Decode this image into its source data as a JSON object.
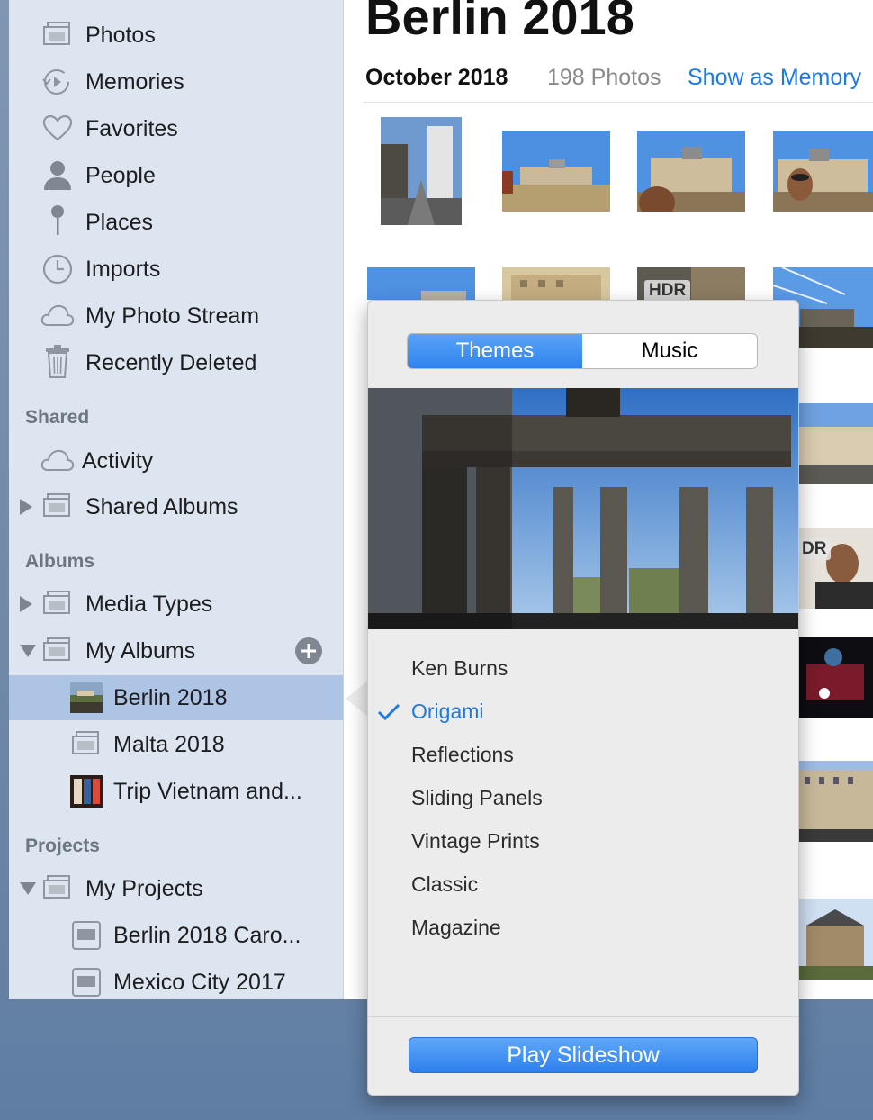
{
  "sidebar": {
    "library_items": [
      {
        "label": "Photos",
        "icon": "photos-stack-icon"
      },
      {
        "label": "Memories",
        "icon": "memories-icon"
      },
      {
        "label": "Favorites",
        "icon": "heart-icon"
      },
      {
        "label": "People",
        "icon": "person-icon"
      },
      {
        "label": "Places",
        "icon": "pin-icon"
      },
      {
        "label": "Imports",
        "icon": "clock-icon"
      },
      {
        "label": "My Photo Stream",
        "icon": "cloud-icon"
      },
      {
        "label": "Recently Deleted",
        "icon": "trash-icon"
      }
    ],
    "shared_header": "Shared",
    "shared_items": [
      {
        "label": "Activity",
        "icon": "cloud-icon"
      },
      {
        "label": "Shared Albums",
        "icon": "album-stack-icon"
      }
    ],
    "albums_header": "Albums",
    "album_groups": [
      {
        "label": "Media Types"
      },
      {
        "label": "My Albums"
      }
    ],
    "albums": [
      {
        "label": "Berlin 2018",
        "selected": true
      },
      {
        "label": "Malta 2018"
      },
      {
        "label": "Trip Vietnam and..."
      }
    ],
    "projects_header": "Projects",
    "projects_group": "My Projects",
    "projects": [
      {
        "label": "Berlin 2018 Caro..."
      },
      {
        "label": "Mexico City 2017"
      }
    ]
  },
  "main": {
    "title": "Berlin 2018",
    "month": "October 2018",
    "count": "198 Photos",
    "show_memory": "Show as Memory",
    "hdr_badge": "HDR",
    "hdr_badge_partial": "DR"
  },
  "popover": {
    "tabs": [
      "Themes",
      "Music"
    ],
    "active_tab": "Themes",
    "themes": [
      "Ken Burns",
      "Origami",
      "Reflections",
      "Sliding Panels",
      "Vintage Prints",
      "Classic",
      "Magazine"
    ],
    "selected_theme": "Origami",
    "play_button": "Play Slideshow"
  },
  "colors": {
    "accent": "#2f82ee",
    "link": "#1f7ae0",
    "sidebar_bg": "#dde6f0",
    "selected_row": "#aec4e4"
  }
}
